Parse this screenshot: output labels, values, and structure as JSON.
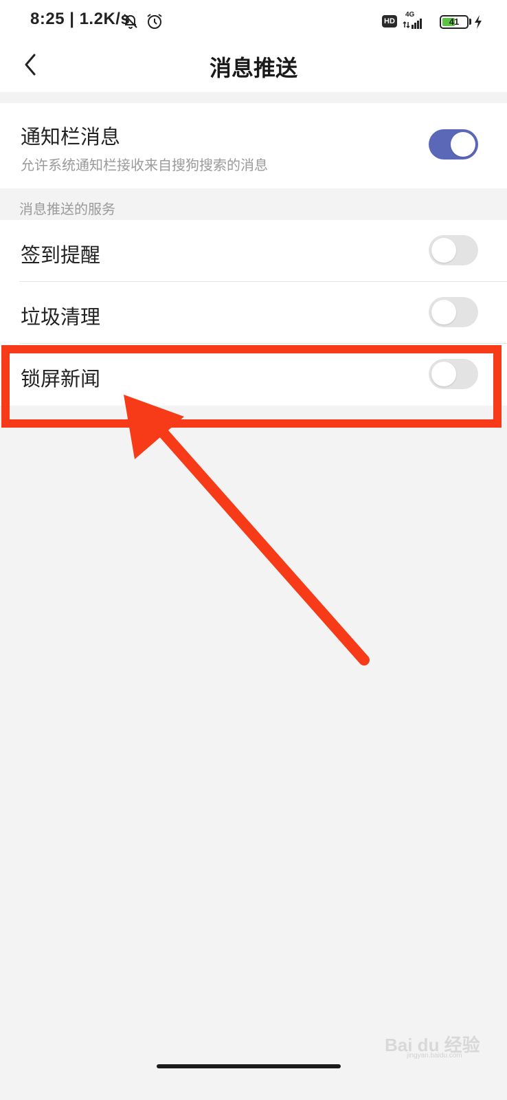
{
  "status_bar": {
    "time_speed": "8:25 | 1.2K/s",
    "hd_label": "HD",
    "network_label": "4G",
    "battery_level": "41"
  },
  "header": {
    "title": "消息推送"
  },
  "notification": {
    "title": "通知栏消息",
    "subtitle": "允许系统通知栏接收来自搜狗搜索的消息",
    "enabled": true
  },
  "services": {
    "header": "消息推送的服务",
    "items": [
      {
        "label": "签到提醒",
        "enabled": false
      },
      {
        "label": "垃圾清理",
        "enabled": false
      },
      {
        "label": "锁屏新闻",
        "enabled": false
      }
    ]
  },
  "watermark": {
    "main": "Bai du 经验",
    "sub": "jingyan.baidu.com"
  },
  "colors": {
    "toggle_on": "#5b68b8",
    "toggle_off": "#e3e3e3",
    "annotation_red": "#f73a17",
    "battery_green": "#5fc148"
  }
}
